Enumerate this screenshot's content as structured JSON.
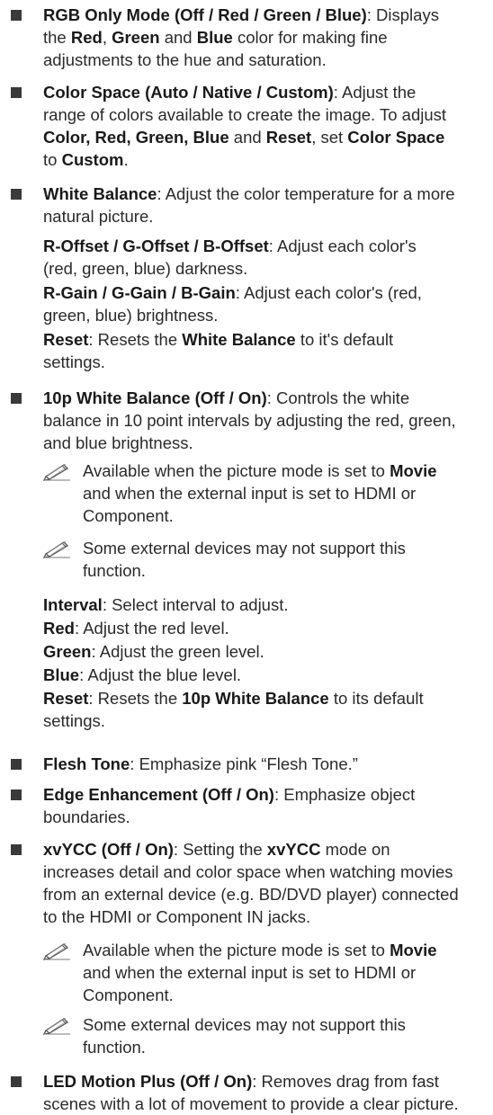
{
  "items": [
    {
      "title": "RGB Only Mode (Off / Red / Green / Blue)",
      "desc_lines": [
        "Displays",
        "the |Red|, |Green| and |Blue| color for making fine",
        "adjustments to the hue and saturation."
      ]
    },
    {
      "title": "Color Space (Auto / Native / Custom)",
      "desc_lines": [
        "Adjust the",
        "range of colors available to create the image. To adjust",
        "|Color, Red, Green, Blue| and |Reset|, set |Color Space|",
        "to |Custom|."
      ]
    },
    {
      "title": "White Balance",
      "desc_lines": [
        "Adjust the color temperature for a more",
        "natural picture."
      ],
      "subs": [
        {
          "lines": [
            "|R-Offset / G-Offset / B-Offset|: Adjust each color's",
            "(red, green, blue) darkness."
          ]
        },
        {
          "lines": [
            "|R-Gain / G-Gain / B-Gain|: Adjust each color's (red,",
            "green, blue) brightness."
          ]
        },
        {
          "lines": [
            "|Reset|: Resets the |White Balance| to it's default",
            "settings."
          ]
        }
      ]
    },
    {
      "title": "10p White Balance (Off / On)",
      "desc_lines": [
        "Controls the white",
        "balance in 10 point intervals by adjusting the red, green,",
        "and blue brightness."
      ],
      "notes": [
        {
          "lines": [
            "Available when the picture mode is set to |Movie|",
            "and when the external input is set to HDMI or",
            "Component."
          ]
        },
        {
          "lines": [
            "Some external devices may not support this",
            "function."
          ]
        }
      ],
      "subs": [
        {
          "lines": [
            "|Interval|: Select interval to adjust."
          ]
        },
        {
          "lines": [
            "|Red|: Adjust the red level."
          ]
        },
        {
          "lines": [
            "|Green|: Adjust the green level."
          ]
        },
        {
          "lines": [
            "|Blue|: Adjust the blue level."
          ]
        },
        {
          "lines": [
            "|Reset|: Resets the |10p White Balance| to its default",
            "settings."
          ]
        }
      ]
    },
    {
      "title": "Flesh Tone",
      "desc_lines": [
        "Emphasize pink “Flesh Tone.”"
      ]
    },
    {
      "title": "Edge Enhancement (Off / On)",
      "desc_lines": [
        "Emphasize object",
        "boundaries."
      ]
    },
    {
      "title": "xvYCC (Off / On)",
      "desc_lines": [
        "Setting the |xvYCC| mode on",
        "increases detail and color space when watching movies",
        "from an external device (e.g. BD/DVD player) connected",
        "to the HDMI or Component IN jacks."
      ],
      "notes": [
        {
          "lines": [
            "Available when the picture mode is set to |Movie|",
            "and when the external input is set to HDMI or",
            "Component."
          ]
        },
        {
          "lines": [
            "Some external devices may not support this",
            "function."
          ]
        }
      ]
    },
    {
      "title": "LED Motion Plus (Off / On)",
      "desc_lines": [
        "Removes drag from fast",
        "scenes with a lot of movement to provide a clear picture."
      ]
    }
  ]
}
